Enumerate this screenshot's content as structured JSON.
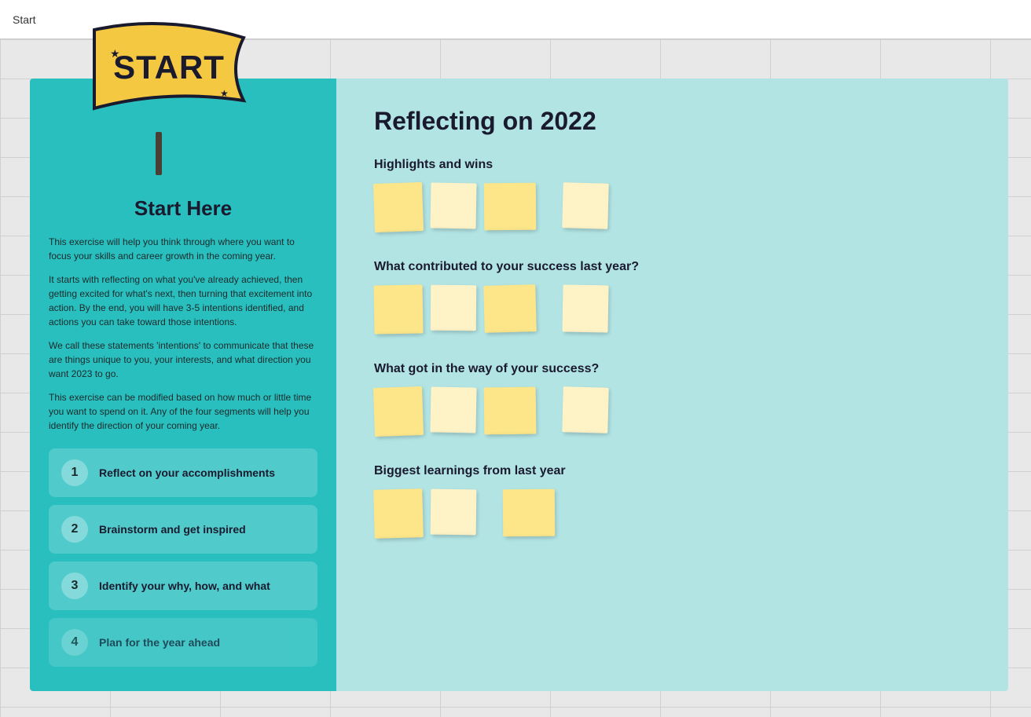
{
  "topbar": {
    "label": "Start"
  },
  "left": {
    "title": "Start Here",
    "paragraphs": [
      "This exercise will help you think through where you want to focus your skills and career growth in the coming year.",
      "It starts with reflecting on what you've already achieved, then getting excited for what's next, then turning that excitement into action. By the end, you will have 3-5 intentions identified, and actions you can take toward those intentions.",
      "We call these statements 'intentions' to communicate that these are things unique to you, your interests, and what direction you want 2023 to go.",
      "This exercise can be modified based on how much or little time you want to spend on it. Any of the four segments will help you identify the direction of your coming year."
    ],
    "steps": [
      {
        "number": "1",
        "label": "Reflect on your accomplishments"
      },
      {
        "number": "2",
        "label": "Brainstorm and get inspired"
      },
      {
        "number": "3",
        "label": "Identify your why, how, and what"
      }
    ]
  },
  "right": {
    "title": "Reflecting on 2022",
    "sections": [
      {
        "heading": "Highlights and wins"
      },
      {
        "heading": "What contributed to your success last year?"
      },
      {
        "heading": "What got in the way of your success?"
      },
      {
        "heading": "Biggest learnings from last year"
      }
    ]
  }
}
